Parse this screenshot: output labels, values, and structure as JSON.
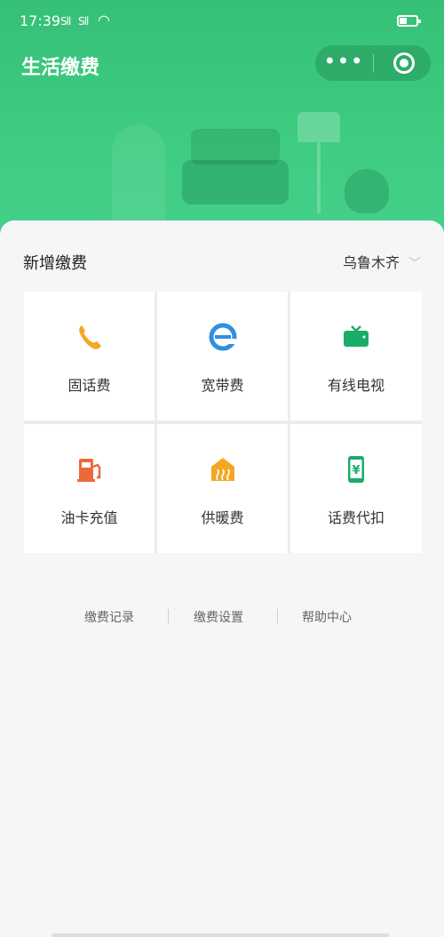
{
  "status": {
    "time": "17:39",
    "signal1": "Sll",
    "signal2": "Sll"
  },
  "header": {
    "title": "生活缴费",
    "more_icon": "more-dots-icon",
    "close_icon": "target-icon"
  },
  "section": {
    "title": "新增缴费",
    "city": "乌鲁木齐"
  },
  "services": [
    {
      "label": "固话费",
      "icon": "phone-icon",
      "color": "#f5a623"
    },
    {
      "label": "宽带费",
      "icon": "broadband-e-icon",
      "color": "#2f8fe0"
    },
    {
      "label": "有线电视",
      "icon": "tv-icon",
      "color": "#1aad6a"
    },
    {
      "label": "油卡充值",
      "icon": "fuel-pump-icon",
      "color": "#ea6a3c"
    },
    {
      "label": "供暖费",
      "icon": "heating-icon",
      "color": "#f5a623"
    },
    {
      "label": "话费代扣",
      "icon": "mobile-yuan-icon",
      "color": "#1aad6a"
    }
  ],
  "links": {
    "records": "缴费记录",
    "settings": "缴费设置",
    "help": "帮助中心"
  }
}
